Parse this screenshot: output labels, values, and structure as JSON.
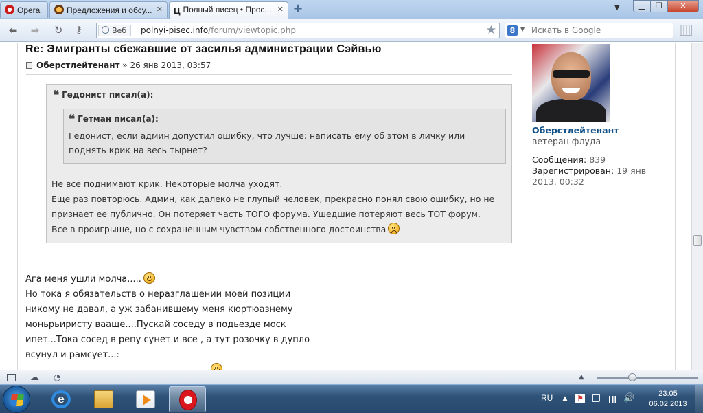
{
  "browser": {
    "tabs": [
      {
        "label": "Opera",
        "active": false
      },
      {
        "label": "Предложения и обсу...",
        "active": false
      },
      {
        "label": "Полный писец • Прос...",
        "active": true
      }
    ],
    "new_tab": "+",
    "url_scheme": "Веб",
    "url_host": "polnyi-pisec.info",
    "url_path": "/forum/viewtopic.php",
    "search_engine_icon": "8",
    "search_placeholder": "Искать в Google"
  },
  "post": {
    "title": "Re: Эмигранты сбежавшие от засилья администрации Сэйвью",
    "author": "Оберстлейтенант",
    "date_sep": " » ",
    "date": "26 янв 2013, 03:57",
    "outer_quote": {
      "cite": "Гедонист писал(а):",
      "lines": [
        "Не все поднимают крик. Некоторые молча уходят.",
        "Еще раз повторюсь. Админ, как далеко не глупый человек, прекрасно понял свою ошибку, но не",
        "признает ее публично. Он потеряет часть ТОГО форума. Ушедшие потеряют весь ТОТ форум.",
        "Все в проигрыше, но с сохраненным чувством собственного достоинства"
      ]
    },
    "inner_quote": {
      "cite": "Гетман писал(а):",
      "lines": [
        "Гедонист, если админ допустил ошибку, что лучше: написать ему об этом в личку или",
        "поднять крик на весь тырнет?"
      ]
    },
    "reply_lines": [
      "Ага меня ушли молча.....",
      "Но тока я обязательств о неразглашении моей позиции",
      "никому не давал, а уж забанившему меня кюртюазнему",
      "моньрьиристу вааще....Пускай соседу в подьезде моск",
      "ипет...Тока сосед в репу сунет и все , а тут розочку в дупло",
      "всунул и рамсует...:"
    ]
  },
  "profile": {
    "name": "Оберстлейтенант",
    "rank": "ветеран флуда",
    "messages_label": "Сообщения:",
    "messages_value": "839",
    "registered_label": "Зарегистрирован:",
    "registered_value_1": "19 янв",
    "registered_value_2": "2013, 00:32"
  },
  "taskbar": {
    "language": "RU",
    "time": "23:05",
    "date": "06.02.2013"
  }
}
